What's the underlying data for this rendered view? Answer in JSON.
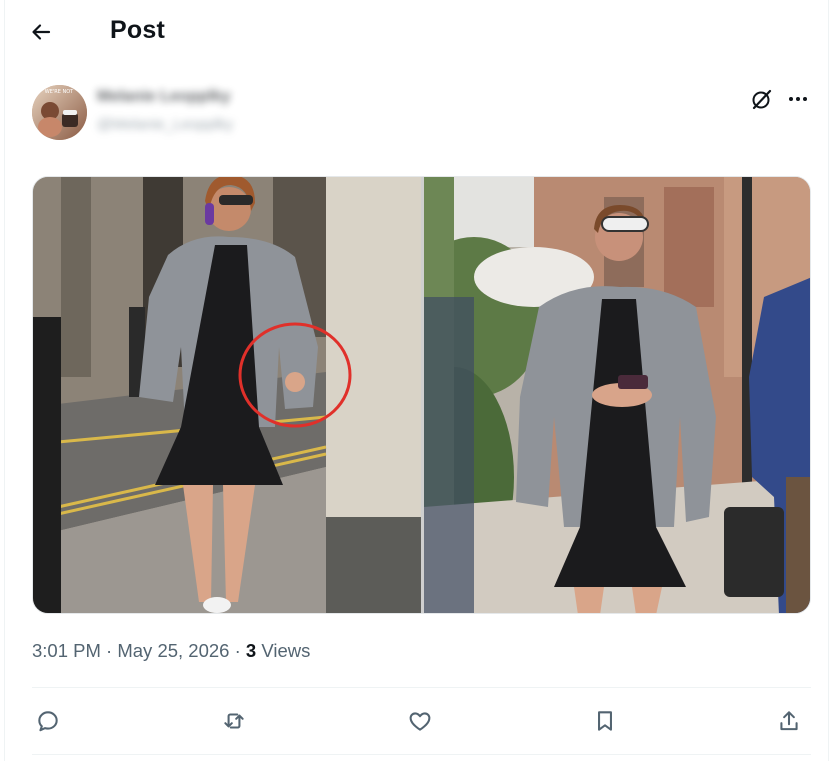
{
  "header": {
    "title": "Post",
    "back_icon": "arrow-left-icon"
  },
  "author": {
    "name": "Melanie Leopplky",
    "handle": "@Melanie_Leopplky",
    "avatar_text": "WE'RE NOT"
  },
  "post": {
    "media_count": 2,
    "annotation_color": "#e0302a"
  },
  "meta": {
    "time": "3:01 PM",
    "separator": "·",
    "date": "May 25, 2026",
    "views_count": "3",
    "views_label": "Views"
  },
  "actions": [
    {
      "icon": "reply-icon"
    },
    {
      "icon": "repost-icon"
    },
    {
      "icon": "like-icon"
    },
    {
      "icon": "bookmark-icon"
    },
    {
      "icon": "share-icon"
    }
  ],
  "colors": {
    "text_primary": "#0f1419",
    "text_secondary": "#536471",
    "divider": "#eff3f4"
  }
}
